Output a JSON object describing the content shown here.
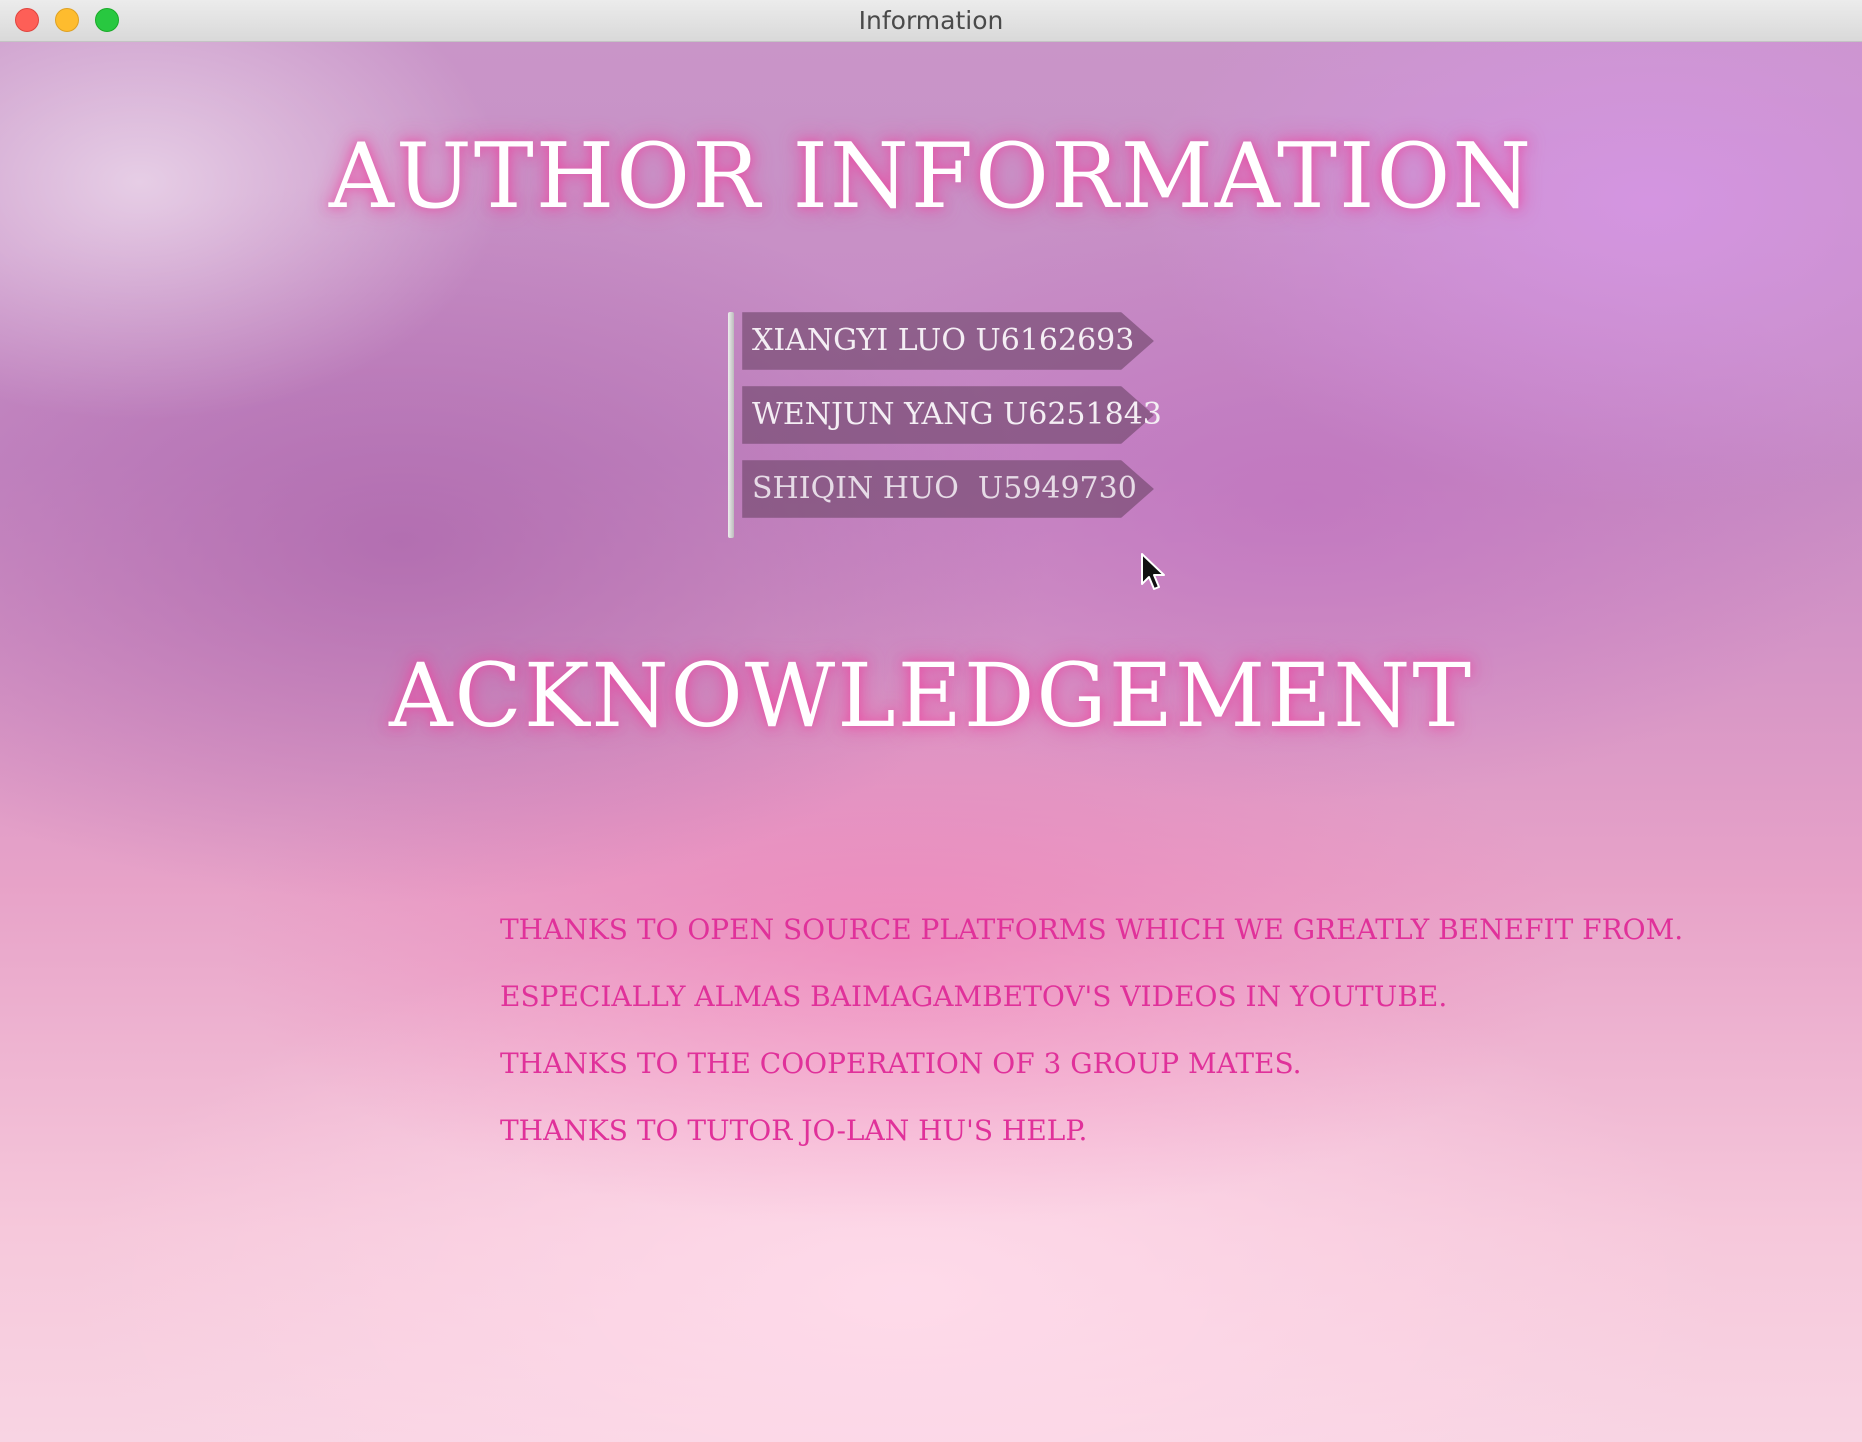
{
  "window": {
    "title": "Information"
  },
  "author_section": {
    "heading": "AUTHOR INFORMATION",
    "authors": [
      {
        "label": "XIANGYI LUO U6162693"
      },
      {
        "label": "WENJUN YANG U6251843"
      },
      {
        "label": "SHIQIN HUO  U5949730"
      }
    ]
  },
  "acknowledgement_section": {
    "heading": "ACKNOWLEDGEMENT",
    "lines": [
      "THANKS TO OPEN SOURCE PLATFORMS WHICH WE GREATLY BENEFIT FROM.",
      "ESPECIALLY ALMAS BAIMAGAMBETOV'S VIDEOS IN YOUTUBE.",
      "THANKS TO THE COOPERATION OF 3 GROUP MATES.",
      "THANKS TO TUTOR JO-LAN HU'S HELP."
    ]
  },
  "colors": {
    "heading_glow": "#ec46a0",
    "ack_text": "#e0319a",
    "author_item_bg": "#6e4669"
  },
  "icons": [
    "close-icon",
    "minimize-icon",
    "maximize-icon",
    "mouse-cursor-icon"
  ]
}
